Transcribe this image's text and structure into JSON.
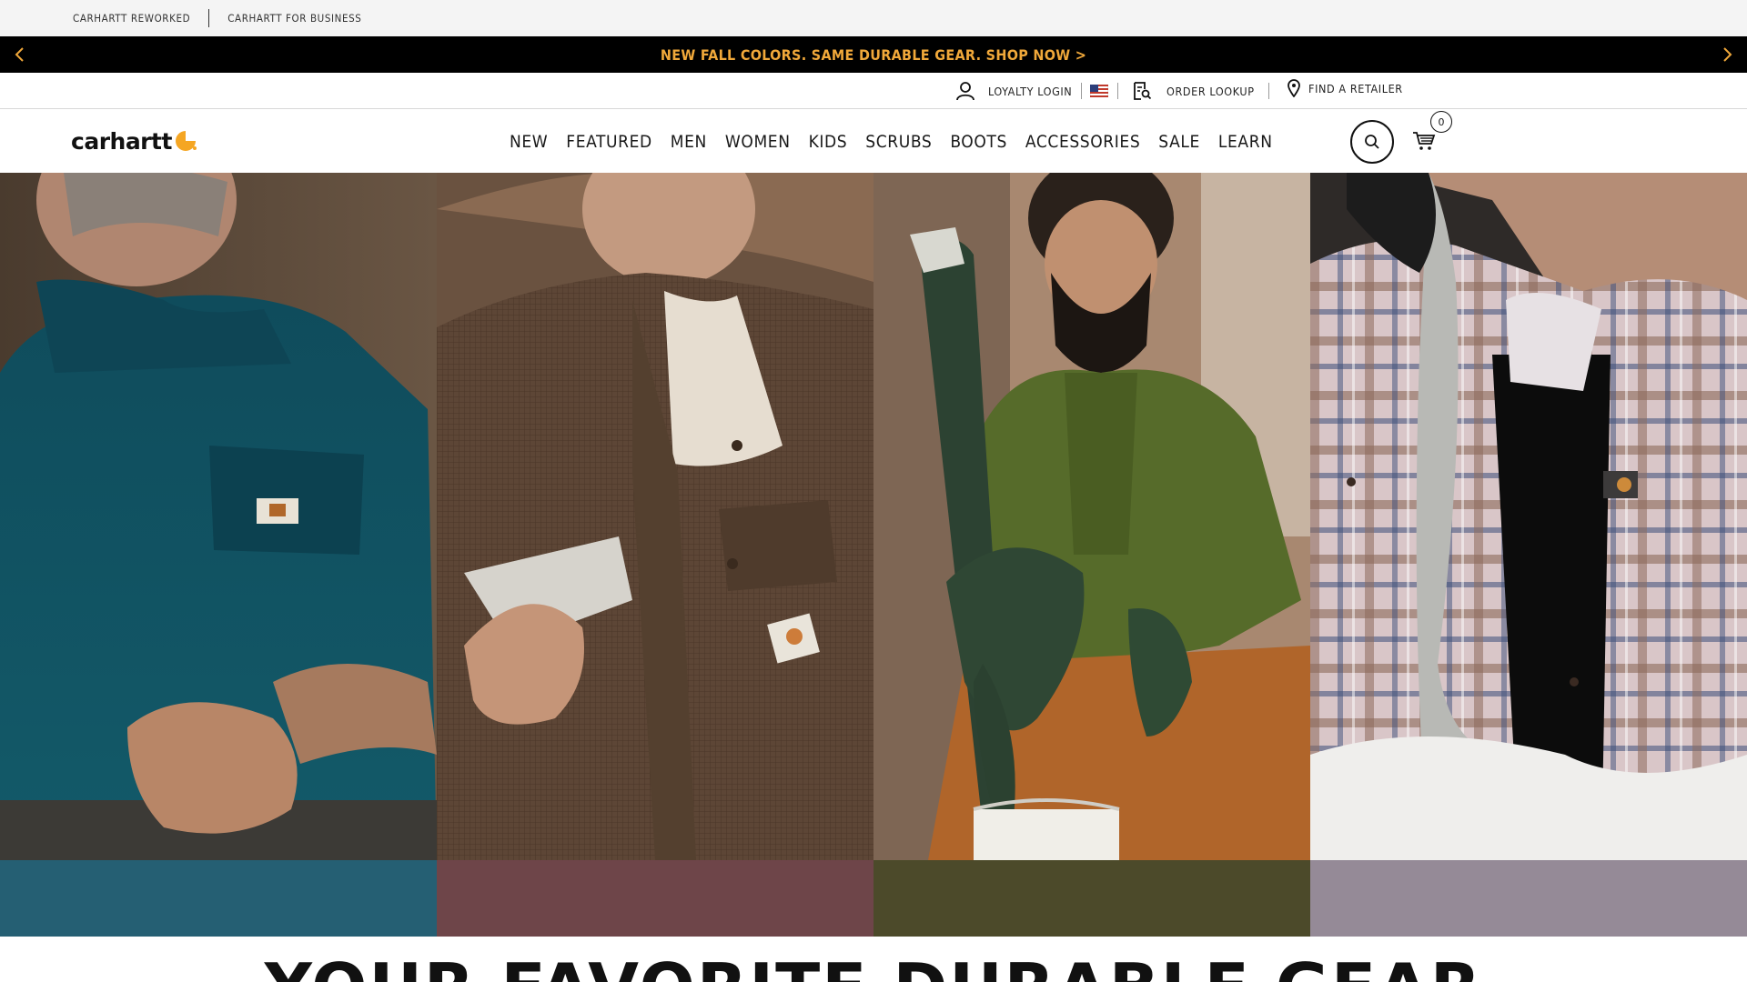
{
  "utility_bar": {
    "links": [
      "CARHARTT REWORKED",
      "CARHARTT FOR BUSINESS"
    ]
  },
  "promo": {
    "text": "NEW FALL COLORS. SAME DURABLE GEAR. SHOP NOW >",
    "text_color": "#f0a83a",
    "prev_icon": "chevron-left-icon",
    "next_icon": "chevron-right-icon"
  },
  "account_bar": {
    "loyalty_login": "LOYALTY LOGIN",
    "order_lookup": "ORDER LOOKUP",
    "find_retailer": "FIND A RETAILER",
    "flag_icon": "us-flag-icon"
  },
  "header": {
    "logo_text": "carhartt",
    "logo_color": "#f5a623",
    "nav": [
      "NEW",
      "FEATURED",
      "MEN",
      "WOMEN",
      "KIDS",
      "SCRUBS",
      "BOOTS",
      "ACCESSORIES",
      "SALE",
      "LEARN"
    ],
    "cart_count": "0"
  },
  "hero": {
    "panels": [
      {
        "name": "teal",
        "swatch_color": "#255f73"
      },
      {
        "name": "brown",
        "swatch_color": "#6e4549"
      },
      {
        "name": "olive",
        "swatch_color": "#4c4a2a"
      },
      {
        "name": "lavender",
        "swatch_color": "#958a97"
      }
    ]
  },
  "section": {
    "heading": "YOUR FAVORITE DURABLE GEAR"
  }
}
